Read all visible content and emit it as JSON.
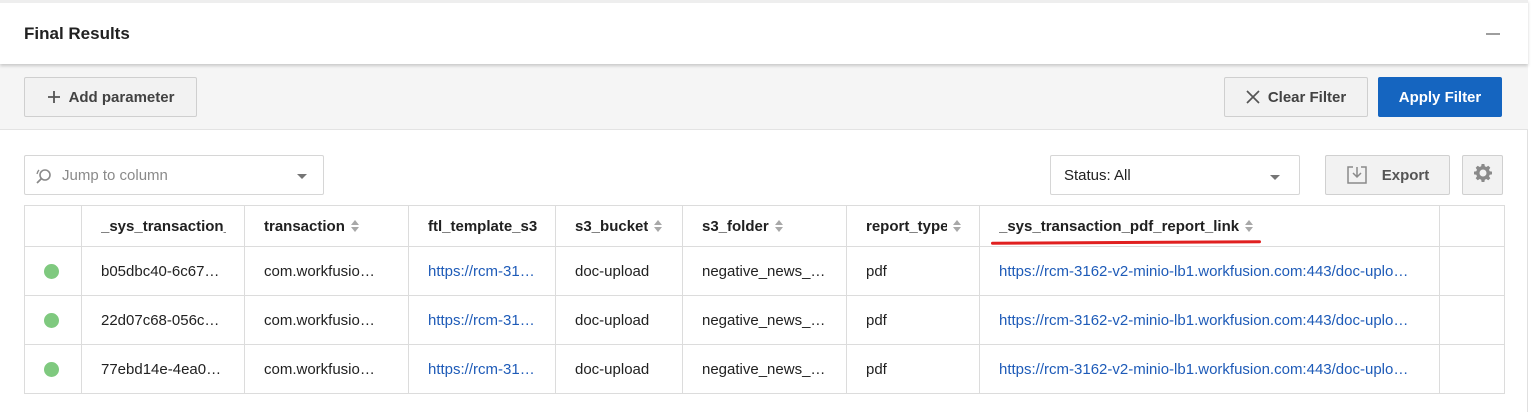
{
  "panel": {
    "title": "Final Results"
  },
  "toolbar": {
    "add_parameter_label": "Add parameter",
    "clear_filter_label": "Clear Filter",
    "apply_filter_label": "Apply Filter"
  },
  "controls": {
    "jump_placeholder": "Jump to column",
    "status_value": "Status: All",
    "export_label": "Export"
  },
  "table": {
    "columns": [
      "",
      "_sys_transaction_",
      "transaction",
      "ftl_template_s3",
      "s3_bucket",
      "s3_folder",
      "report_type",
      "_sys_transaction_pdf_report_link",
      ""
    ],
    "rows": [
      {
        "status_color": "#7fc97f",
        "sys_transaction": "b05dbc40-6c67…",
        "transaction": "com.workfusio…",
        "ftl_template": "https://rcm-31…",
        "s3_bucket": "doc-upload",
        "s3_folder": "negative_news_…",
        "report_type": "pdf",
        "pdf_link": "https://rcm-3162-v2-minio-lb1.workfusion.com:443/doc-uplo…"
      },
      {
        "status_color": "#7fc97f",
        "sys_transaction": "22d07c68-056c…",
        "transaction": "com.workfusio…",
        "ftl_template": "https://rcm-31…",
        "s3_bucket": "doc-upload",
        "s3_folder": "negative_news_…",
        "report_type": "pdf",
        "pdf_link": "https://rcm-3162-v2-minio-lb1.workfusion.com:443/doc-uplo…"
      },
      {
        "status_color": "#7fc97f",
        "sys_transaction": "77ebd14e-4ea0…",
        "transaction": "com.workfusio…",
        "ftl_template": "https://rcm-31…",
        "s3_bucket": "doc-upload",
        "s3_folder": "negative_news_…",
        "report_type": "pdf",
        "pdf_link": "https://rcm-3162-v2-minio-lb1.workfusion.com:443/doc-uplo…"
      }
    ]
  },
  "colors": {
    "primary": "#1565c0",
    "link": "#1e5bb8",
    "status_ok": "#7fc97f",
    "annotation": "#e02020"
  },
  "icons": {
    "add": "plus-icon",
    "clear": "close-icon",
    "jump": "search-icon",
    "export": "download-icon",
    "settings": "gear-icon",
    "collapse": "minimize-icon"
  }
}
